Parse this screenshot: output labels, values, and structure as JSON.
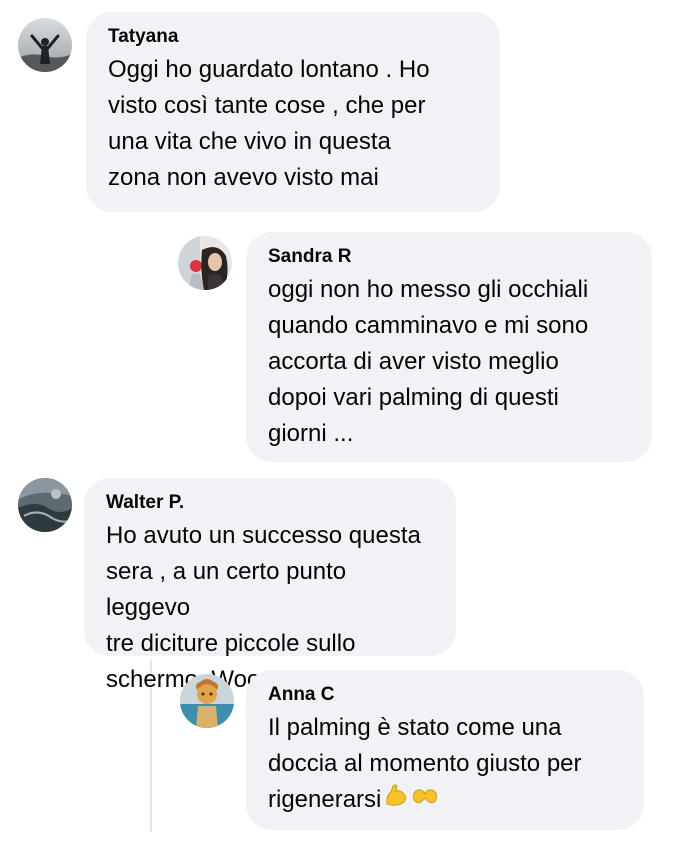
{
  "comments": [
    {
      "author": "Tatyana",
      "text": "Oggi ho guardato lontano . Ho\nvisto così tante cose , che per\nuna vita che vivo in questa\nzona non avevo visto mai",
      "avatar_icon": "profile-photo-tatyana"
    },
    {
      "author": "Sandra R",
      "text": "oggi non ho messo gli occhiali\nquando camminavo e mi sono\naccorta di aver visto meglio\ndopoi vari palming di questi\ngiorni ...",
      "avatar_icon": "profile-photo-sandra"
    },
    {
      "author": "Walter P.",
      "text": "Ho avuto un successo questa\nsera , a un certo punto leggevo\ntre diciture piccole sullo\nschermo. Wooow",
      "avatar_icon": "profile-photo-walter"
    },
    {
      "author": "Anna C",
      "text": "Il palming è stato come una\ndoccia al momento giusto per\nrigenerarsi",
      "emojis": [
        "flexed-biceps-icon",
        "heart-hands-icon"
      ],
      "avatar_icon": "profile-photo-anna"
    }
  ],
  "colors": {
    "bubble": "#f0f2f5",
    "text": "#050505",
    "thread_line": "#e4e6eb",
    "emoji_yellow": "#f7c325"
  }
}
